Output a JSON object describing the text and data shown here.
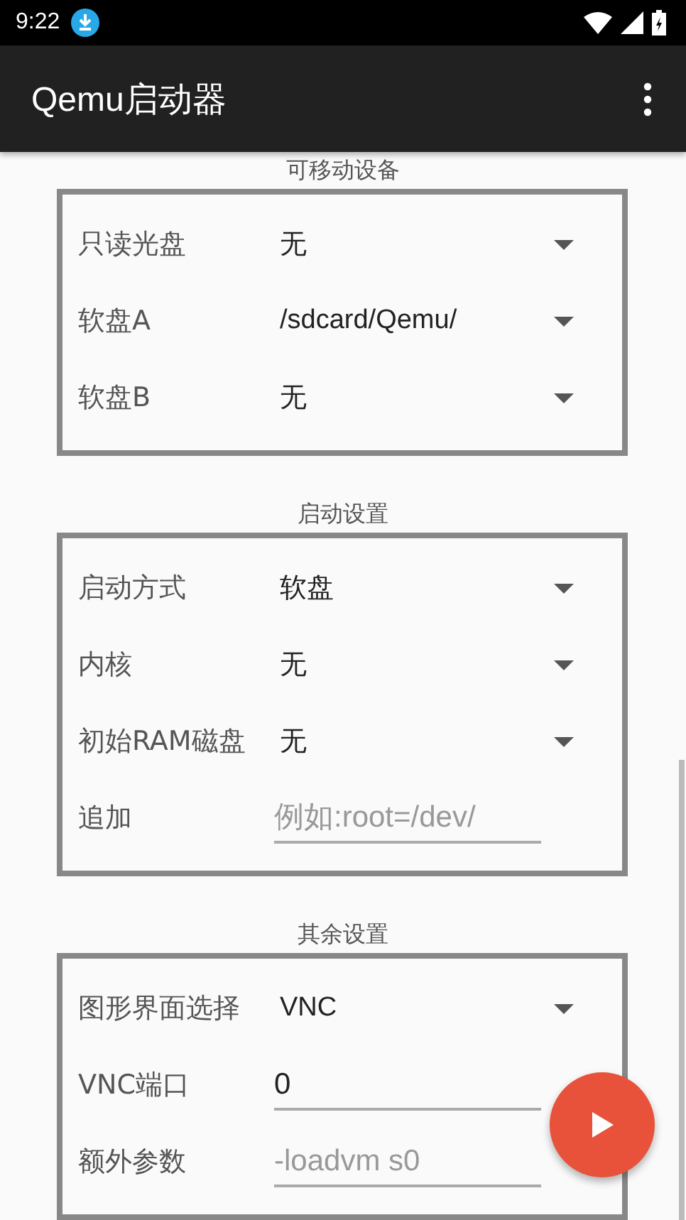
{
  "status_bar": {
    "time": "9:22"
  },
  "app_bar": {
    "title": "Qemu启动器"
  },
  "sections": [
    {
      "title": "可移动设备",
      "rows": [
        {
          "kind": "dropdown",
          "label": "只读光盘",
          "value": "无"
        },
        {
          "kind": "dropdown",
          "label": "软盘A",
          "value": "/sdcard/Qemu/"
        },
        {
          "kind": "dropdown",
          "label": "软盘B",
          "value": "无"
        }
      ]
    },
    {
      "title": "启动设置",
      "rows": [
        {
          "kind": "dropdown",
          "label": "启动方式",
          "value": "软盘"
        },
        {
          "kind": "dropdown",
          "label": "内核",
          "value": "无"
        },
        {
          "kind": "dropdown",
          "label": "初始RAM磁盘",
          "value": "无"
        },
        {
          "kind": "input",
          "label": "追加",
          "placeholder": "例如:root=/dev/"
        }
      ]
    },
    {
      "title": "其余设置",
      "rows": [
        {
          "kind": "dropdown",
          "label": "图形界面选择",
          "value": "VNC"
        },
        {
          "kind": "input",
          "label": "VNC端口",
          "value": "0"
        },
        {
          "kind": "input",
          "label": "额外参数",
          "placeholder": "-loadvm s0"
        }
      ]
    }
  ]
}
